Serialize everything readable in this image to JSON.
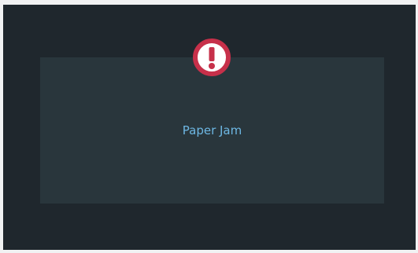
{
  "dialog": {
    "message": "Paper Jam",
    "icon": "exclamation-alert-icon",
    "colors": {
      "screen_background": "#1f272d",
      "panel_background": "#29363c",
      "message_text": "#6db7e3",
      "icon_ring": "#c7304a",
      "icon_fill": "#ffffff"
    }
  }
}
